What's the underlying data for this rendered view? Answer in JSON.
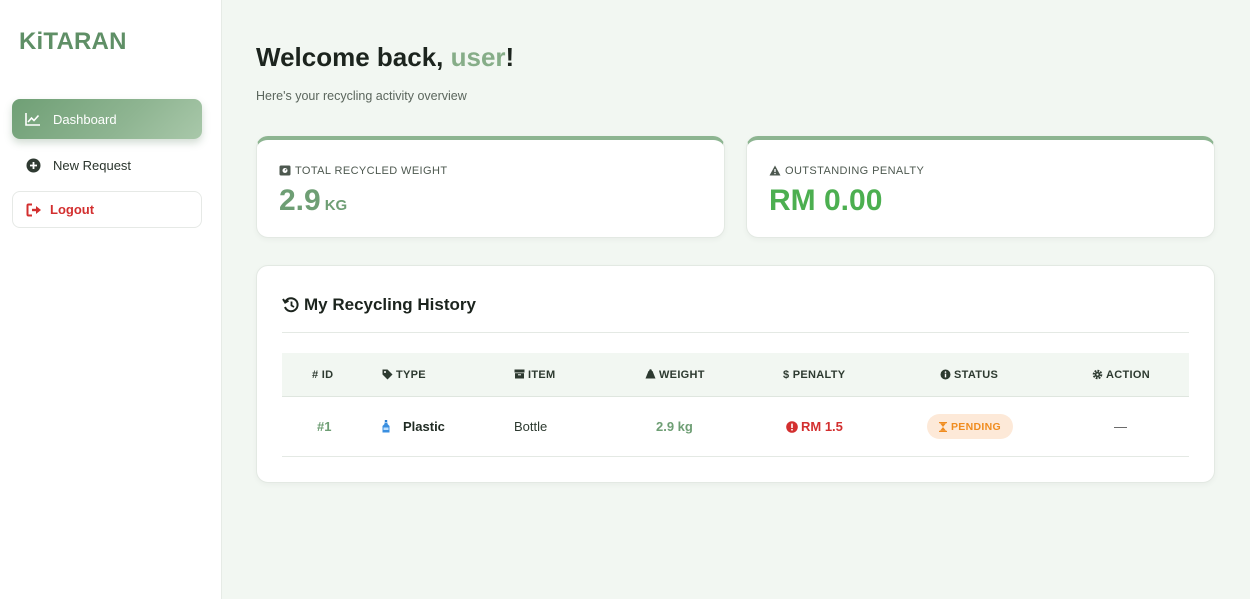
{
  "brand": "KiTARAN",
  "sidebar": {
    "items": [
      {
        "label": "Dashboard",
        "icon": "chart-line-icon",
        "active": true
      },
      {
        "label": "New Request",
        "icon": "plus-circle-icon"
      },
      {
        "label": "Logout",
        "icon": "logout-icon"
      }
    ]
  },
  "header": {
    "welcome_prefix": "Welcome back, ",
    "username": "user",
    "welcome_suffix": "!",
    "subtitle": "Here's your recycling activity overview"
  },
  "stats": {
    "weight": {
      "label": "TOTAL RECYCLED WEIGHT",
      "value": "2.9",
      "unit": "KG",
      "icon": "scale-icon"
    },
    "penalty": {
      "label": "OUTSTANDING PENALTY",
      "value": "RM 0.00",
      "icon": "warning-icon"
    }
  },
  "history": {
    "title": "My Recycling History",
    "columns": {
      "id": "# ID",
      "type": "TYPE",
      "item": "ITEM",
      "weight": "WEIGHT",
      "penalty": "$ PENALTY",
      "status": "STATUS",
      "action": "ACTION"
    },
    "rows": [
      {
        "id": "#1",
        "type": "Plastic",
        "item": "Bottle",
        "weight": "2.9 kg",
        "penalty": "RM 1.5",
        "status": "PENDING",
        "action": "—"
      }
    ]
  },
  "colors": {
    "brand": "#5f8f66",
    "accent": "#6e9e74",
    "penalty": "#d32f2f",
    "pending": "#f08c1f"
  }
}
